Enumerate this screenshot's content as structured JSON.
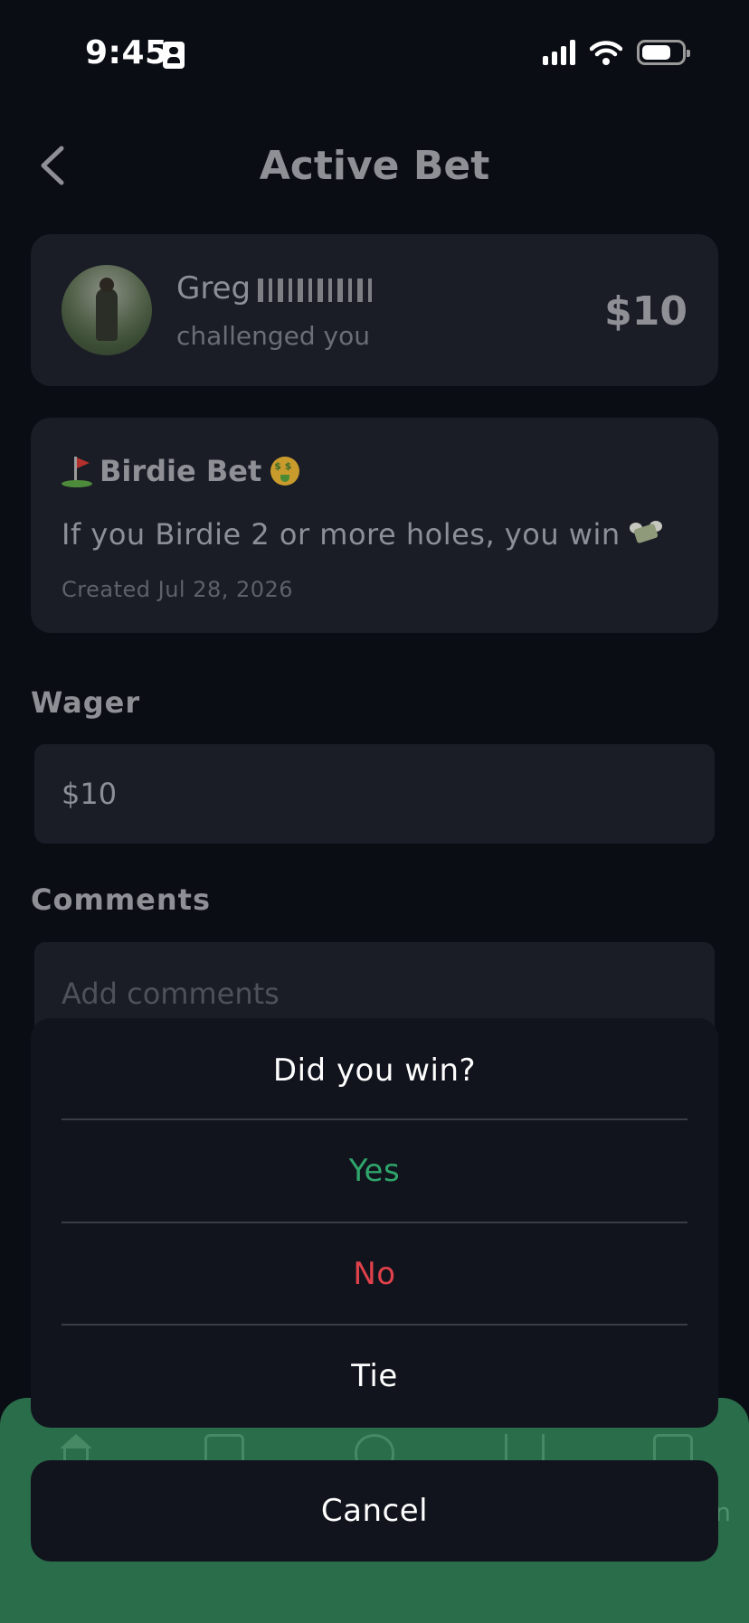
{
  "status_bar": {
    "time": "9:45"
  },
  "header": {
    "title": "Active Bet",
    "back_icon": "chevron-left-icon"
  },
  "challenger": {
    "first_name": "Greg",
    "subtitle": "challenged you",
    "amount": "$10"
  },
  "bet": {
    "title": "Birdie Bet",
    "description": "If you Birdie 2 or more holes, you win",
    "created": "Created Jul 28, 2026",
    "title_icons": [
      "golf-flag-icon",
      "money-mouth-face-icon"
    ],
    "description_icon": "money-with-wings-icon"
  },
  "wager": {
    "label": "Wager",
    "value": "$10"
  },
  "comments": {
    "label": "Comments",
    "placeholder": "Add comments"
  },
  "action_sheet": {
    "title": "Did you win?",
    "options": [
      {
        "label": "Yes",
        "color": "#2fa56b"
      },
      {
        "label": "No",
        "color": "#e0414b"
      },
      {
        "label": "Tie",
        "color": "#ffffff"
      }
    ],
    "cancel_label": "Cancel"
  },
  "bottom_nav": {
    "background": "#2a6d4b",
    "icons": [
      "home-icon",
      "card-icon",
      "flame-icon",
      "list-icon",
      "burst-icon"
    ],
    "peek_text": "n"
  }
}
